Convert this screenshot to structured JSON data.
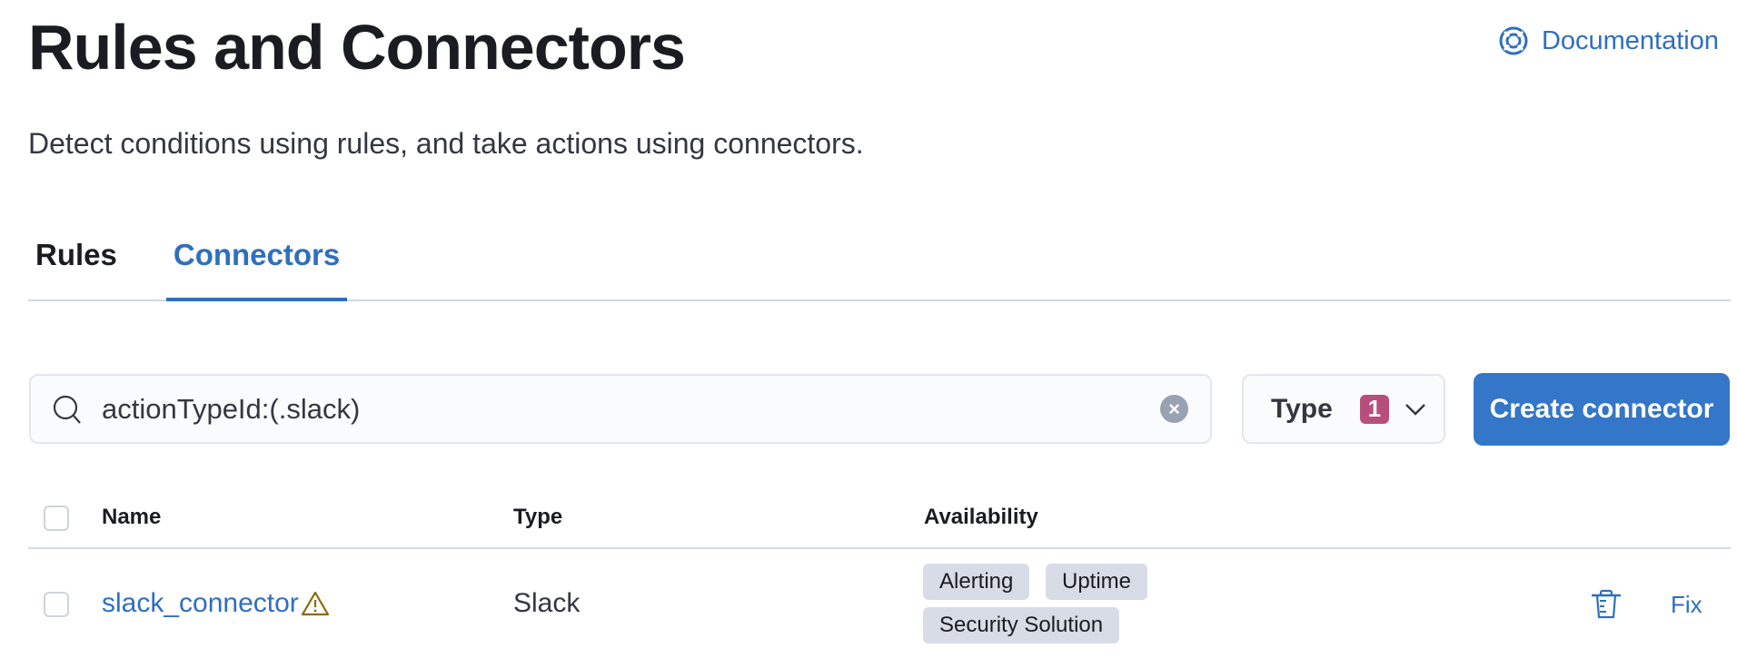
{
  "header": {
    "title": "Rules and Connectors",
    "subtitle": "Detect conditions using rules, and take actions using connectors.",
    "documentation_link": "Documentation",
    "documentation_icon": "lifebuoy-icon"
  },
  "tabs": [
    {
      "label": "Rules",
      "active": false
    },
    {
      "label": "Connectors",
      "active": true
    }
  ],
  "toolbar": {
    "search_value": "actionTypeId:(.slack)",
    "search_icon": "search-icon",
    "clear_icon": "clear-icon",
    "type_filter_label": "Type",
    "type_filter_count": "1",
    "create_button_label": "Create connector"
  },
  "table": {
    "columns": [
      "Name",
      "Type",
      "Availability"
    ],
    "rows": [
      {
        "name": "slack_connector",
        "warning": true,
        "type": "Slack",
        "availability": [
          "Alerting",
          "Uptime",
          "Security Solution"
        ],
        "action_label": "Fix"
      }
    ]
  },
  "colors": {
    "accent": "#2f6fbe",
    "primary_button": "#3476c7",
    "badge": "#b84e7c",
    "warning": "#8a6a0a",
    "pill_bg": "#d8dce6"
  }
}
